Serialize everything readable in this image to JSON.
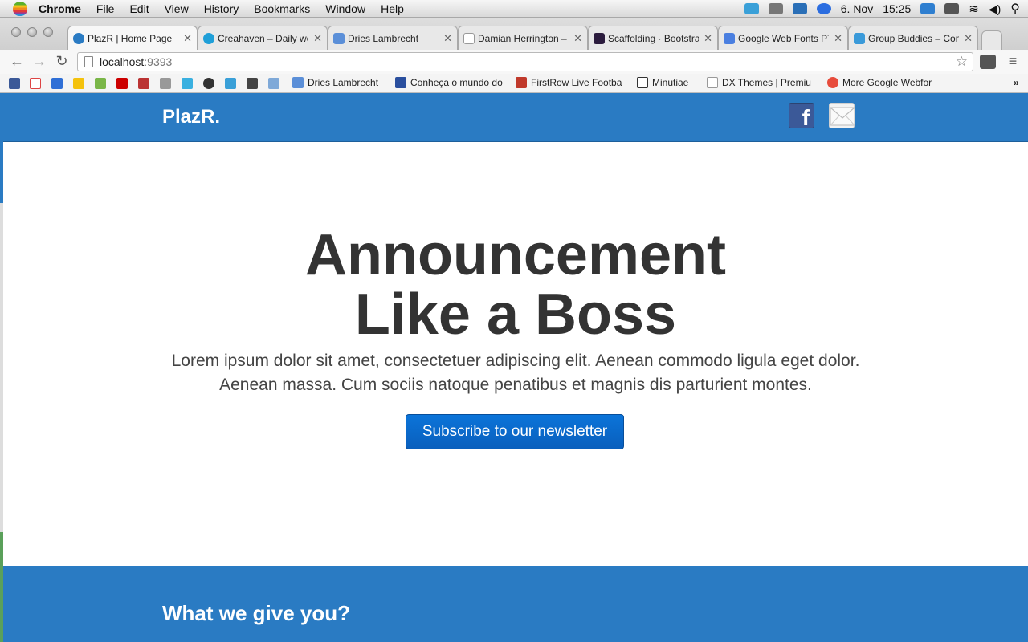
{
  "menubar": {
    "app": "Chrome",
    "items": [
      "File",
      "Edit",
      "View",
      "History",
      "Bookmarks",
      "Window",
      "Help"
    ],
    "date": "6. Nov",
    "time": "15:25"
  },
  "tabs": [
    {
      "title": "PlazR | Home Page",
      "favicon_color": "#2a7bc3",
      "active": true
    },
    {
      "title": "Creahaven – Daily web",
      "favicon_color": "#1f9fd8",
      "active": false
    },
    {
      "title": "Dries Lambrecht",
      "favicon_color": "#5b8fd8",
      "active": false
    },
    {
      "title": "Damian Herrington –",
      "favicon_color": "#cccccc",
      "active": false
    },
    {
      "title": "Scaffolding · Bootstrap",
      "favicon_color": "#2b1b3d",
      "active": false
    },
    {
      "title": "Google Web Fonts PT",
      "favicon_color": "#4a7fe0",
      "active": false
    },
    {
      "title": "Group Buddies – Con",
      "favicon_color": "#3a9ad9",
      "active": false
    }
  ],
  "omnibox": {
    "host": "localhost",
    "port": ":9393"
  },
  "bookmarks": [
    {
      "label": "Dries Lambrecht",
      "color": "#5b8fd8"
    },
    {
      "label": "Conheça o mundo do",
      "color": "#2a4f9e"
    },
    {
      "label": "FirstRow Live Footba",
      "color": "#c0392b"
    },
    {
      "label": "Minutiae",
      "color": "#222222"
    },
    {
      "label": "DX Themes | Premiu",
      "color": "#cccccc"
    },
    {
      "label": "More Google Webfor",
      "color": "#e74c3c"
    }
  ],
  "site": {
    "logo": "PlazR.",
    "hero_title_line1": "Announcement",
    "hero_title_line2": "Like a Boss",
    "hero_text_line1": "Lorem ipsum dolor sit amet, consectetuer adipiscing elit. Aenean commodo ligula eget dolor.",
    "hero_text_line2": "Aenean massa. Cum sociis natoque penatibus et magnis dis parturient montes.",
    "subscribe_label": "Subscribe to our newsletter",
    "features_title": "What we give you?",
    "facebook_letter": "f"
  },
  "colors": {
    "brand": "#2a7bc3",
    "button": "#0a66c8",
    "heading": "#333333"
  }
}
